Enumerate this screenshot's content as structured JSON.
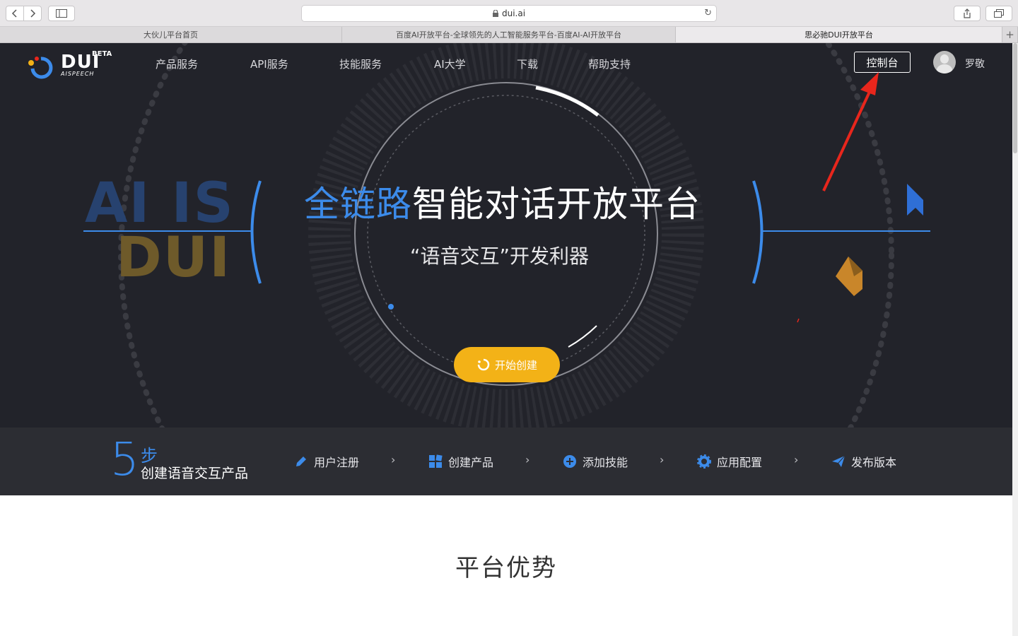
{
  "browser": {
    "address": "dui.ai",
    "tabs": [
      {
        "label": "大伙儿平台首页",
        "active": false
      },
      {
        "label": "百度AI开放平台-全球领先的人工智能服务平台-百度AI-AI开放平台",
        "active": false
      },
      {
        "label": "思必驰DUI开放平台",
        "active": true
      }
    ]
  },
  "header": {
    "logo_text": "DUI",
    "logo_beta": "BETA",
    "logo_sub": "AISPEECH",
    "nav": [
      "产品服务",
      "API服务",
      "技能服务",
      "AI大学",
      "下载",
      "帮助支持"
    ],
    "console_label": "控制台",
    "username": "罗敬"
  },
  "hero": {
    "title_highlight": "全链路",
    "title_rest": "智能对话开放平台",
    "subtitle": "“语音交互”开发利器",
    "start_label": "开始创建",
    "decor_left_line1": "AI IS",
    "decor_left_line2": "DUI"
  },
  "steps": {
    "number": "5",
    "unit": "步",
    "title": "创建语音交互产品",
    "items": [
      {
        "label": "用户注册",
        "icon": "pencil-icon"
      },
      {
        "label": "创建产品",
        "icon": "grid-icon"
      },
      {
        "label": "添加技能",
        "icon": "plus-circle-icon"
      },
      {
        "label": "应用配置",
        "icon": "gear-icon"
      },
      {
        "label": "发布版本",
        "icon": "paper-plane-icon"
      }
    ],
    "arrow": "›"
  },
  "section": {
    "title": "平台优势"
  },
  "colors": {
    "hero_bg": "#22232a",
    "accent_blue": "#3c8bea",
    "accent_yellow": "#f3b217",
    "annotation_red": "#e8261c"
  }
}
